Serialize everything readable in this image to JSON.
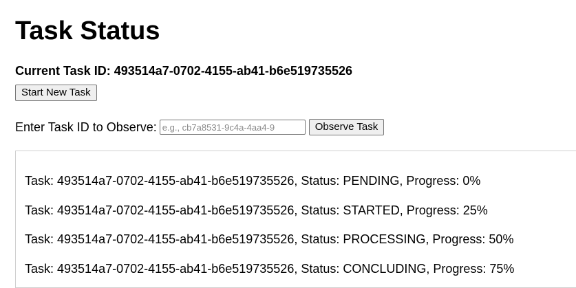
{
  "page": {
    "title": "Task Status",
    "current_task_label": "Current Task ID: 493514a7-0702-4155-ab41-b6e519735526"
  },
  "controls": {
    "start_button_label": "Start New Task",
    "observe_label": "Enter Task ID to Observe:",
    "task_id_input_value": "",
    "task_id_input_placeholder": "e.g., cb7a8531-9c4a-4aa4-9",
    "observe_button_label": "Observe Task"
  },
  "log": {
    "lines": [
      "Task: 493514a7-0702-4155-ab41-b6e519735526, Status: PENDING, Progress: 0%",
      "Task: 493514a7-0702-4155-ab41-b6e519735526, Status: STARTED, Progress: 25%",
      "Task: 493514a7-0702-4155-ab41-b6e519735526, Status: PROCESSING, Progress: 50%",
      "Task: 493514a7-0702-4155-ab41-b6e519735526, Status: CONCLUDING, Progress: 75%"
    ]
  }
}
